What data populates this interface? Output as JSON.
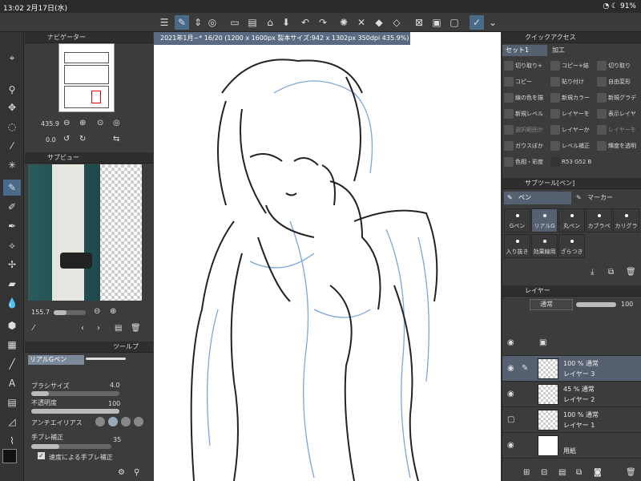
{
  "status": {
    "time": "13:02",
    "date": "2月17日(水)",
    "battery": "91%"
  },
  "document": {
    "tab": "2021年1月~* 16/20 (1200 x 1600px 製本サイズ:942 x 1302px 350dpi 435.9%)"
  },
  "navigator": {
    "title": "ナビゲーター",
    "zoom": "435.9",
    "rotate": "0.0"
  },
  "subview": {
    "title": "サブビュー",
    "zoom": "155.7"
  },
  "toolprop": {
    "tab": "ツールプ",
    "brush": "リアルGペン",
    "size_label": "ブラシサイズ",
    "size_value": "4.0",
    "opacity_label": "不透明度",
    "opacity_value": "100",
    "aa_label": "アンチエイリアス",
    "stab_label": "手ブレ補正",
    "stab_value": "35",
    "speed_label": "速度による手ブレ補正"
  },
  "quick": {
    "title": "クイックアクセス",
    "set": "セット1",
    "edit": "加工",
    "items": [
      "切り取り+",
      "コピー+結",
      "切り取り",
      "コピー",
      "貼り付け",
      "自由変形",
      "線の色を描",
      "新規カラー",
      "新規グラデ",
      "新規レベル",
      "レイヤーを",
      "表示レイヤ",
      "選択範囲か",
      "レイヤーか",
      "レイヤーを",
      "ガウスぼか",
      "レベル補正",
      "輝度を透明",
      "色相・彩度",
      "R53 G52 B"
    ]
  },
  "subtool": {
    "title": "サブツール[ペン]",
    "tab1": "ペン",
    "tab2": "マーカー",
    "brushes": [
      "Gペン",
      "リアルG",
      "丸ペン",
      "カブラペ",
      "カリグラ",
      "入り抜き",
      "効果線用",
      "ざらつき"
    ]
  },
  "layers": {
    "title": "レイヤー",
    "blend": "通常",
    "opacity": "100",
    "rows": [
      {
        "mode": "",
        "name": ""
      },
      {
        "mode": "100 % 通常",
        "name": "レイヤー 3"
      },
      {
        "mode": "45 % 通常",
        "name": "レイヤー 2"
      },
      {
        "mode": "100 % 通常",
        "name": "レイヤー 1"
      },
      {
        "mode": "",
        "name": "用紙"
      }
    ]
  },
  "colors": {
    "accent": "#4a6a8a",
    "sketch_blue": "#7aa8d8",
    "line": "#222222"
  }
}
